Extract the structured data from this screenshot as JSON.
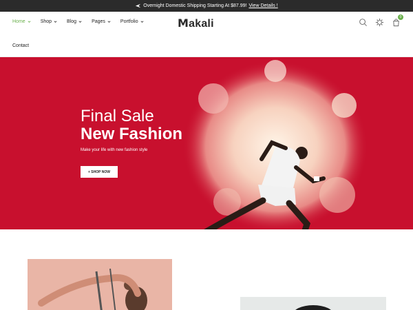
{
  "topbar": {
    "message": "Overnight Domestic Shipping Starting At $87.99!",
    "link_label": "View Details !"
  },
  "nav": {
    "items": [
      {
        "label": "Home",
        "active": true
      },
      {
        "label": "Shop"
      },
      {
        "label": "Blog"
      },
      {
        "label": "Pages"
      },
      {
        "label": "Portfolio"
      }
    ],
    "contact_label": "Contact"
  },
  "logo": {
    "first": "M",
    "rest": "akali"
  },
  "header_icons": {
    "search": "search-icon",
    "settings": "gear-icon",
    "cart": "cart-icon",
    "cart_count": "0"
  },
  "hero": {
    "title_line1": "Final Sale",
    "title_line2": "New Fashion",
    "subtitle": "Make your life with new fashion style",
    "button_label": "+ SHOP NOW",
    "background": "#c8102e"
  },
  "colors": {
    "accent": "#6ab04c",
    "topbar": "#2b2b2b"
  }
}
